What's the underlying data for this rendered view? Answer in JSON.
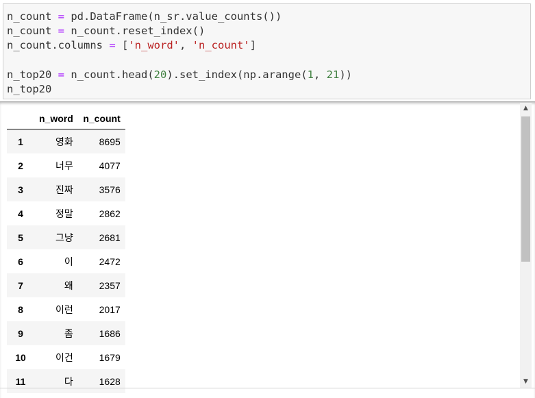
{
  "code": {
    "lines": [
      [
        {
          "t": "n_count ",
          "c": ""
        },
        {
          "t": "=",
          "c": "op"
        },
        {
          "t": " pd.DataFrame(n_sr.value_counts())",
          "c": ""
        }
      ],
      [
        {
          "t": "n_count ",
          "c": ""
        },
        {
          "t": "=",
          "c": "op"
        },
        {
          "t": " n_count.reset_index()",
          "c": ""
        }
      ],
      [
        {
          "t": "n_count.columns ",
          "c": ""
        },
        {
          "t": "=",
          "c": "op"
        },
        {
          "t": " [",
          "c": ""
        },
        {
          "t": "'n_word'",
          "c": "str"
        },
        {
          "t": ", ",
          "c": ""
        },
        {
          "t": "'n_count'",
          "c": "str"
        },
        {
          "t": "]",
          "c": ""
        }
      ],
      [],
      [
        {
          "t": "n_top20 ",
          "c": ""
        },
        {
          "t": "=",
          "c": "op"
        },
        {
          "t": " n_count.head(",
          "c": ""
        },
        {
          "t": "20",
          "c": "num"
        },
        {
          "t": ").set_index(np.arange(",
          "c": ""
        },
        {
          "t": "1",
          "c": "num"
        },
        {
          "t": ", ",
          "c": ""
        },
        {
          "t": "21",
          "c": "num"
        },
        {
          "t": "))",
          "c": ""
        }
      ],
      [
        {
          "t": "n_top20",
          "c": ""
        }
      ]
    ]
  },
  "table": {
    "columns": [
      "n_word",
      "n_count"
    ],
    "rows": [
      {
        "index": "1",
        "n_word": "영화",
        "n_count": "8695"
      },
      {
        "index": "2",
        "n_word": "너무",
        "n_count": "4077"
      },
      {
        "index": "3",
        "n_word": "진짜",
        "n_count": "3576"
      },
      {
        "index": "4",
        "n_word": "정말",
        "n_count": "2862"
      },
      {
        "index": "5",
        "n_word": "그냥",
        "n_count": "2681"
      },
      {
        "index": "6",
        "n_word": "이",
        "n_count": "2472"
      },
      {
        "index": "7",
        "n_word": "왜",
        "n_count": "2357"
      },
      {
        "index": "8",
        "n_word": "이런",
        "n_count": "2017"
      },
      {
        "index": "9",
        "n_word": "좀",
        "n_count": "1686"
      },
      {
        "index": "10",
        "n_word": "이건",
        "n_count": "1679"
      },
      {
        "index": "11",
        "n_word": "다",
        "n_count": "1628"
      }
    ]
  },
  "scrollbar": {
    "up_arrow": "▲",
    "down_arrow": "▼",
    "up_icon": "triangle-up-icon",
    "down_icon": "triangle-down-icon"
  }
}
